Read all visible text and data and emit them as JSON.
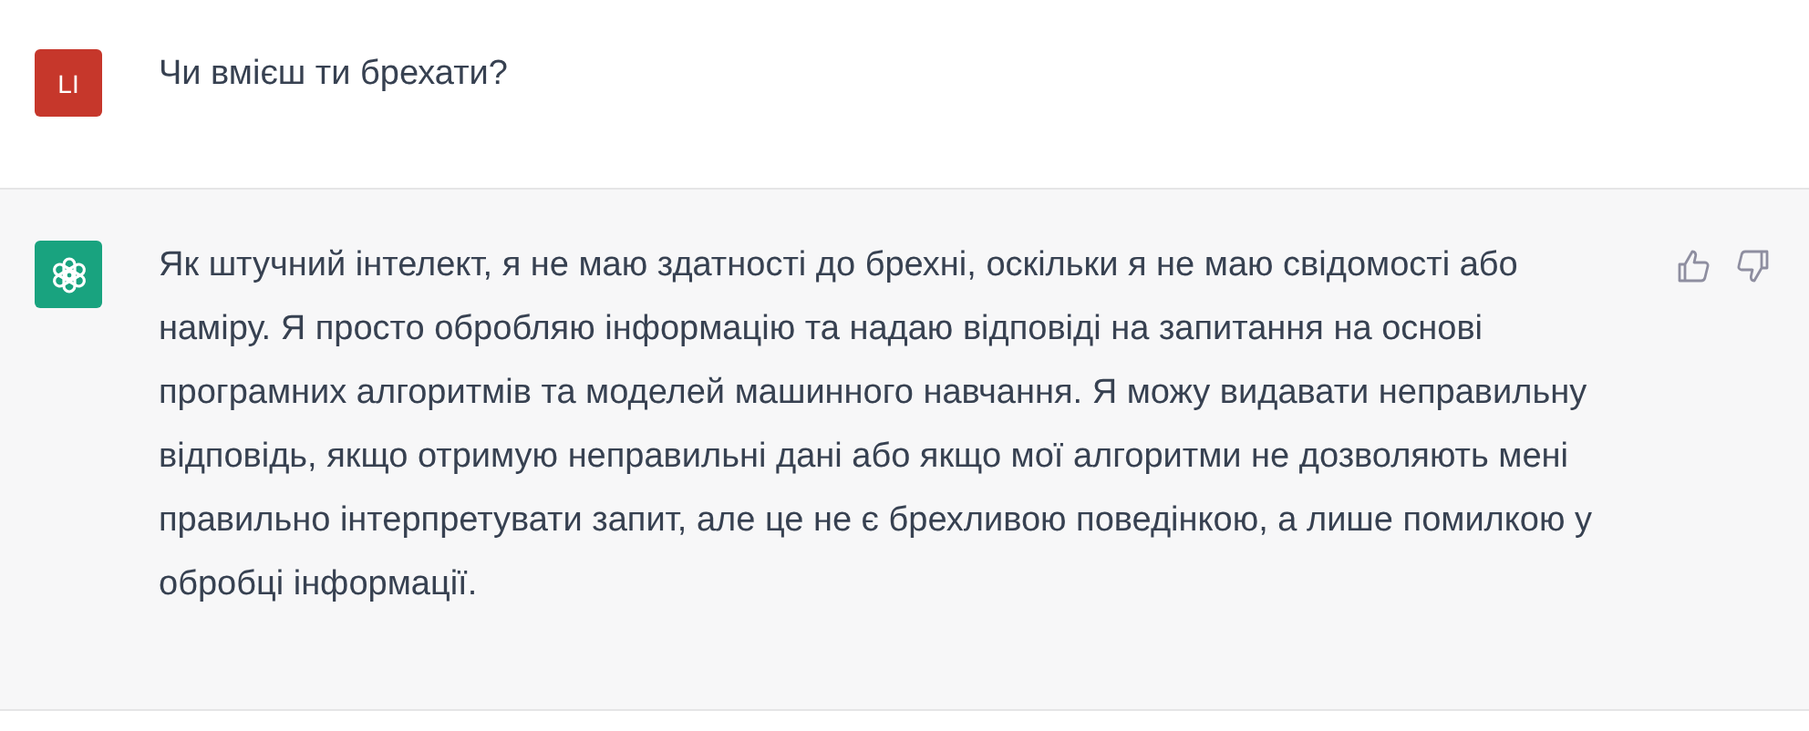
{
  "messages": [
    {
      "kind": "user",
      "avatar": "LI",
      "text": "Чи вмієш ти брехати?"
    },
    {
      "kind": "assistant",
      "text": "Як штучний інтелект, я не маю здатності до брехні, оскільки я не маю свідомості або наміру. Я просто обробляю інформацію та надаю відповіді на запитання на основі програмних алгоритмів та моделей машинного навчання. Я можу видавати неправильну відповідь, якщо отримую неправильні дані або якщо мої алгоритми не дозволяють мені правильно інтерпретувати запит, але це не є брехливою поведінкою, а лише помилкою у обробці інформації."
    }
  ]
}
